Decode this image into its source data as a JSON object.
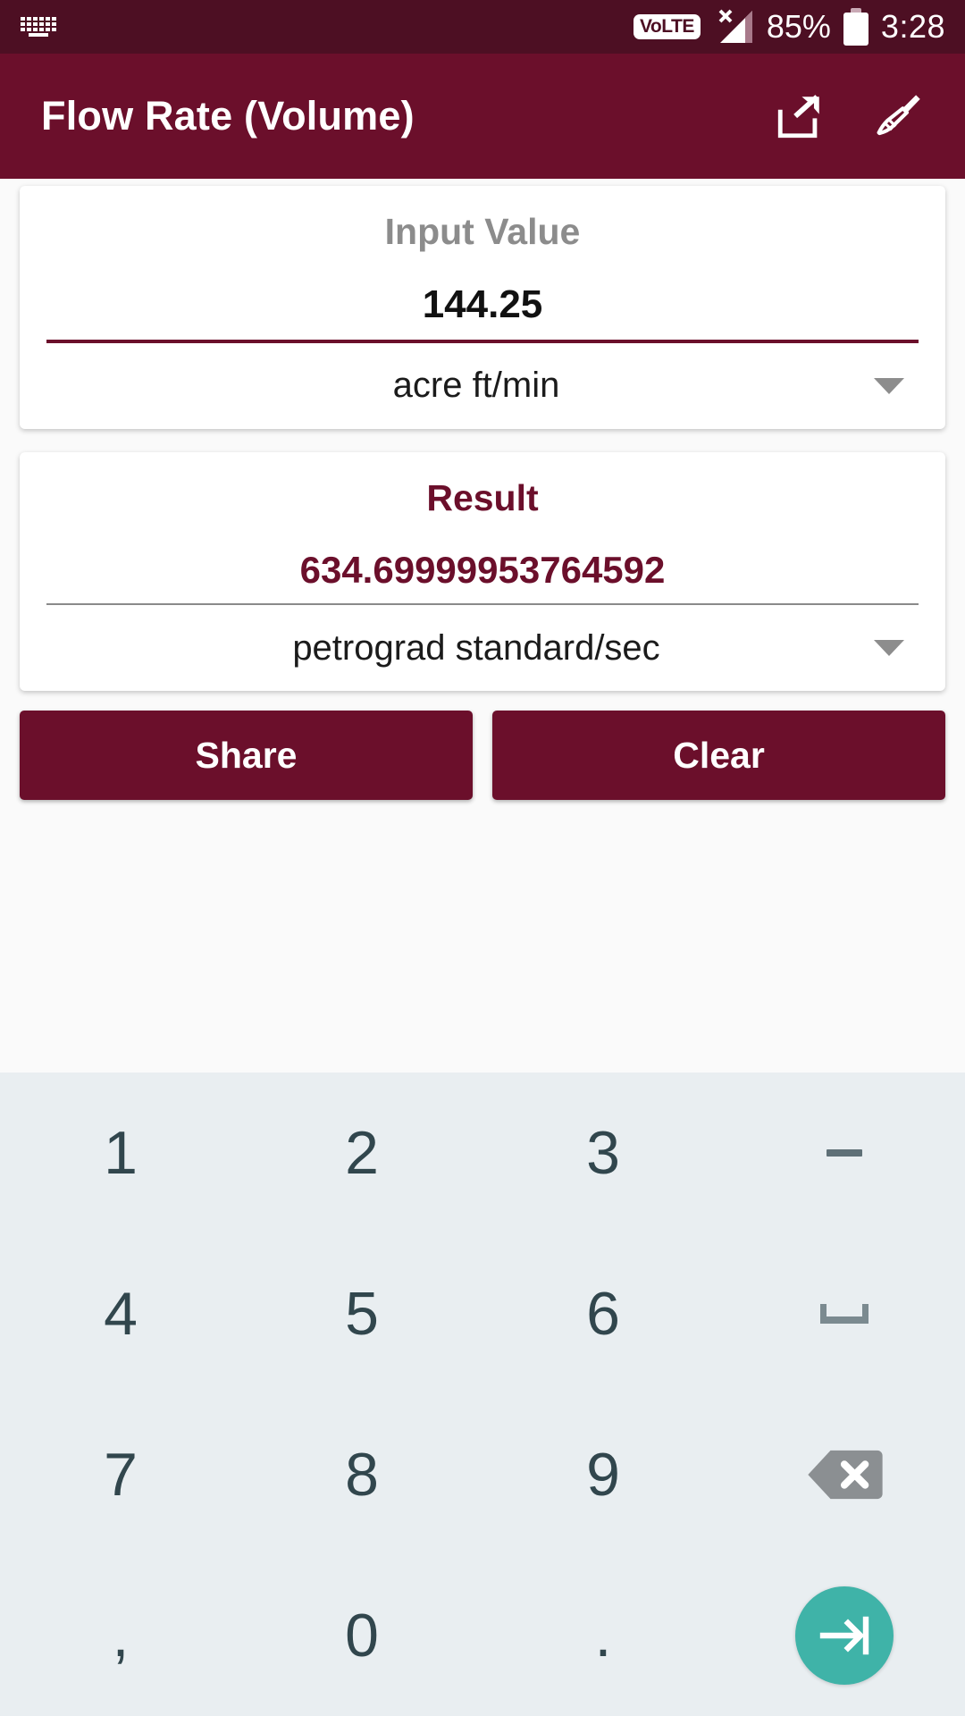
{
  "status_bar": {
    "keyboard_icon": "keyboard-icon",
    "volte_label": "VoLTE",
    "signal_icon": "signal-no-service-icon",
    "battery_percent": "85%",
    "battery_icon": "battery-icon",
    "time": "3:28"
  },
  "app_bar": {
    "title": "Flow Rate (Volume)",
    "share_icon": "share-icon",
    "clear_icon": "broom-icon"
  },
  "input_card": {
    "label": "Input Value",
    "value": "144.25",
    "unit": "acre ft/min",
    "caret_icon": "chevron-down-icon"
  },
  "result_card": {
    "label": "Result",
    "value": "634.69999953764592",
    "unit": "petrograd standard/sec",
    "caret_icon": "chevron-down-icon"
  },
  "actions": {
    "share_label": "Share",
    "clear_label": "Clear"
  },
  "keyboard": {
    "rows": [
      [
        {
          "key": "1",
          "type": "text"
        },
        {
          "key": "2",
          "type": "text"
        },
        {
          "key": "3",
          "type": "text"
        },
        {
          "key": "minus-key",
          "type": "minus"
        }
      ],
      [
        {
          "key": "4",
          "type": "text"
        },
        {
          "key": "5",
          "type": "text"
        },
        {
          "key": "6",
          "type": "text"
        },
        {
          "key": "space-key",
          "type": "space"
        }
      ],
      [
        {
          "key": "7",
          "type": "text"
        },
        {
          "key": "8",
          "type": "text"
        },
        {
          "key": "9",
          "type": "text"
        },
        {
          "key": "backspace-key",
          "type": "backspace"
        }
      ],
      [
        {
          "key": ",",
          "type": "text"
        },
        {
          "key": "0",
          "type": "text"
        },
        {
          "key": ".",
          "type": "text"
        },
        {
          "key": "enter-key",
          "type": "enter"
        }
      ]
    ]
  },
  "colors": {
    "status_bar": "#4d0f23",
    "app_bar": "#6b0f2b",
    "accent": "#6b0f2b",
    "keyboard_bg": "#e9eef1",
    "key_text": "#31464d",
    "enter_button": "#3fb3a8",
    "label_gray": "#8c8c8c"
  }
}
